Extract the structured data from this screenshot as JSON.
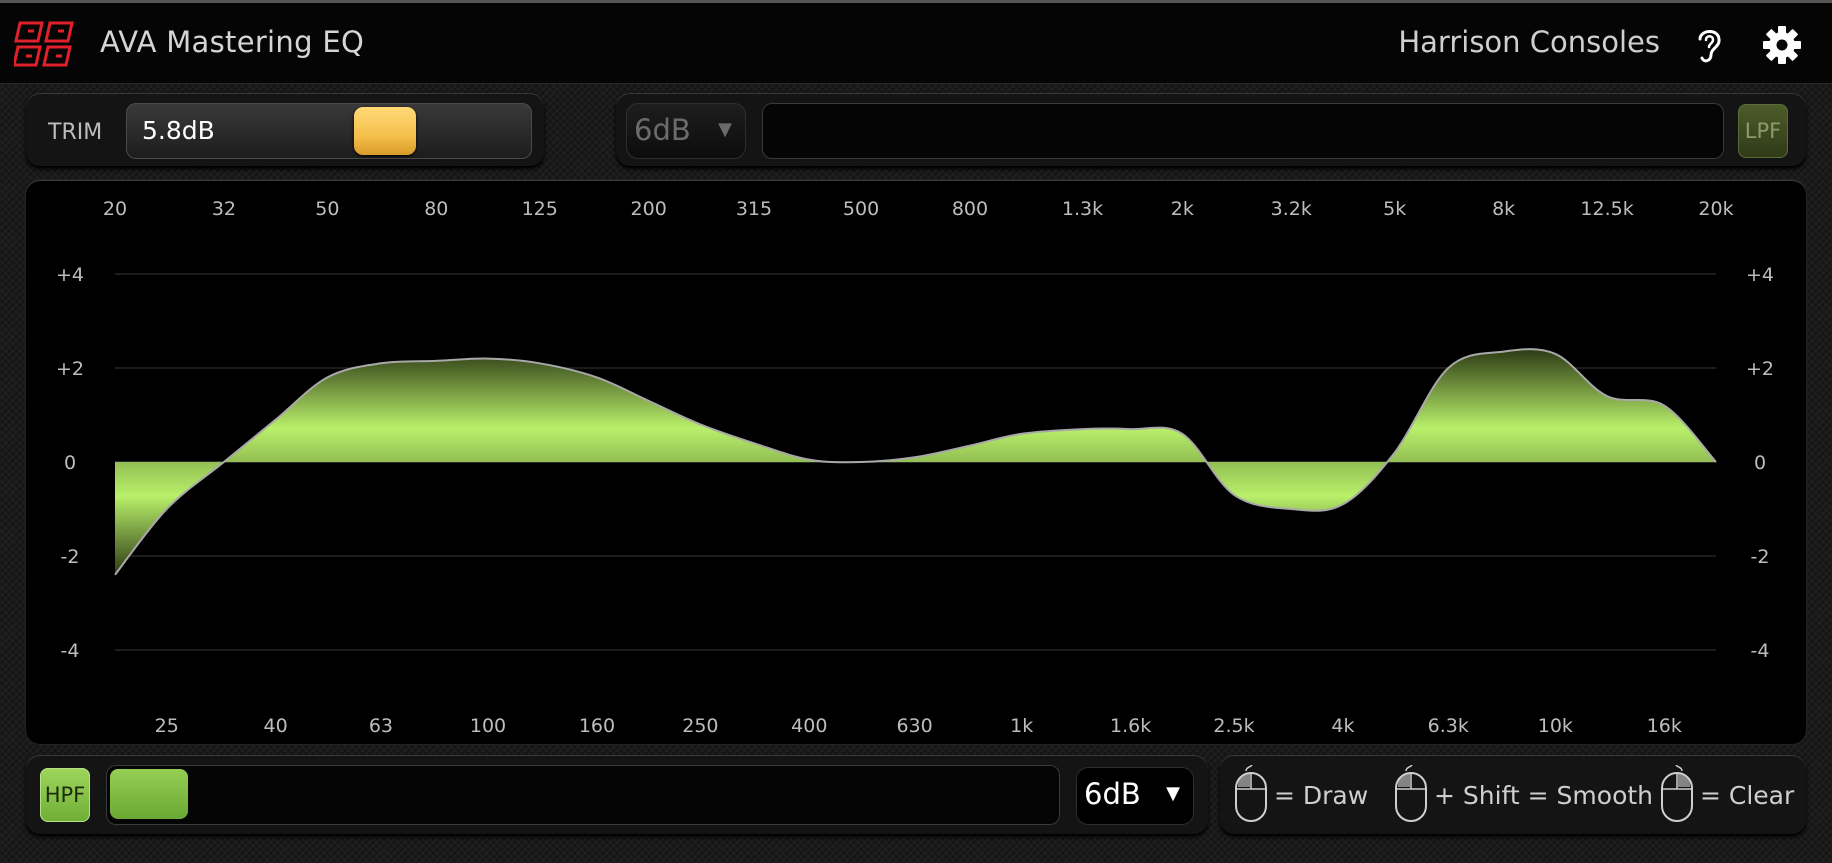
{
  "app": {
    "title": "AVA Mastering EQ",
    "brand": "Harrison Consoles"
  },
  "icons": {
    "logo": "harrison-logo",
    "ear": "ear-icon",
    "settings": "gear-icon",
    "mouse": "mouse-icon"
  },
  "colors": {
    "accent_green": "#a8e05f",
    "trim_thumb": "#f5c04b",
    "panel": "#141414"
  },
  "trim": {
    "label": "TRIM",
    "value": "5.8dB"
  },
  "lpf": {
    "slope": "6dB",
    "button": "LPF"
  },
  "hpf": {
    "button": "HPF",
    "slope": "6dB"
  },
  "graph": {
    "top_freq_labels": [
      "20",
      "32",
      "50",
      "80",
      "125",
      "200",
      "315",
      "500",
      "800",
      "1.3k",
      "2k",
      "3.2k",
      "5k",
      "8k",
      "12.5k",
      "20k"
    ],
    "bottom_freq_labels": [
      "25",
      "40",
      "63",
      "100",
      "160",
      "250",
      "400",
      "630",
      "1k",
      "1.6k",
      "2.5k",
      "4k",
      "6.3k",
      "10k",
      "16k"
    ],
    "db_labels": [
      "+4",
      "+2",
      "0",
      "-2",
      "-4"
    ],
    "db_values": [
      4,
      2,
      0,
      -2,
      -4
    ]
  },
  "chart_data": {
    "type": "area",
    "xlabel": "",
    "ylabel": "",
    "x_scale": "log",
    "x_unit": "Hz",
    "ylim": [
      -5,
      5
    ],
    "series": [
      {
        "x": [
          20,
          25,
          32,
          40,
          50,
          63,
          80,
          100,
          125,
          160,
          200,
          250,
          315,
          400,
          500,
          630,
          800,
          1000,
          1300,
          1600,
          2000,
          2500,
          3200,
          4000,
          5000,
          6300,
          8000,
          10000,
          12500,
          16000,
          20000
        ],
        "values": [
          -2.4,
          -1.0,
          0.0,
          0.9,
          1.8,
          2.1,
          2.15,
          2.2,
          2.1,
          1.8,
          1.3,
          0.8,
          0.4,
          0.05,
          0.0,
          0.1,
          0.35,
          0.6,
          0.7,
          0.7,
          0.6,
          -0.7,
          -1.0,
          -0.9,
          0.2,
          2.0,
          2.35,
          2.3,
          1.4,
          1.2,
          0.0
        ]
      }
    ]
  },
  "hints": {
    "draw": "= Draw",
    "smooth": "+ Shift = Smooth",
    "clear": "= Clear"
  }
}
